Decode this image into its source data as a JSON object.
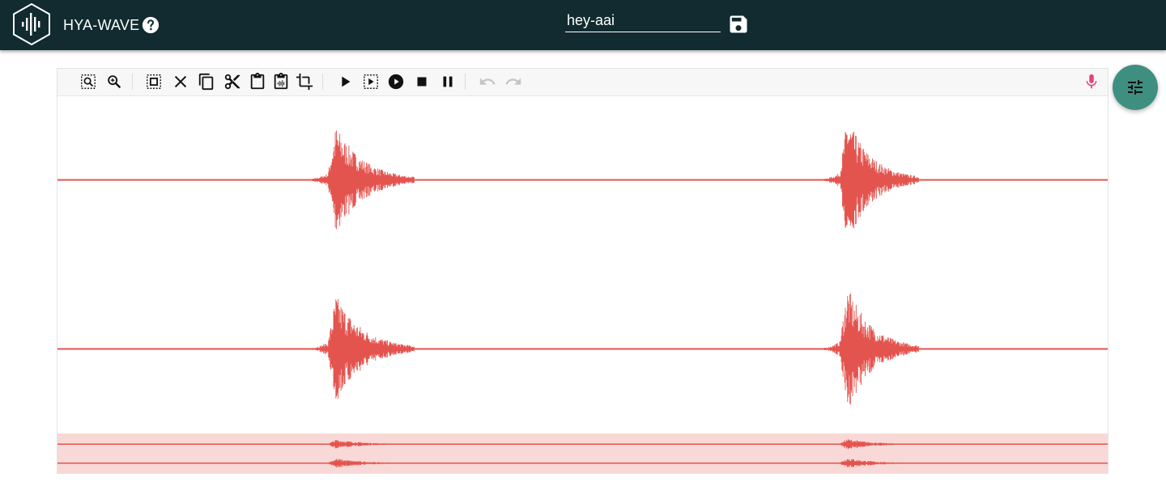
{
  "app": {
    "title": "HYA-WAVE"
  },
  "file": {
    "name": "hey-aai"
  },
  "colors": {
    "header_bg": "#112b30",
    "waveform": "#e4544f",
    "overview_bg": "#f9d9d7",
    "fab": "#3f8f80",
    "record": "#e0457b",
    "disabled": "#c4c4c4"
  },
  "icons": {
    "logo": "hexagon-waveform-icon",
    "help": "help-circle-icon",
    "save": "floppy-disk-icon",
    "zoom_selection": "zoom-to-selection-icon",
    "zoom": "zoom-icon",
    "select_all": "select-all-icon",
    "clear": "close-icon",
    "copy": "copy-icon",
    "cut": "scissors-icon",
    "paste": "clipboard-icon",
    "paste_waveform": "paste-waveform-icon",
    "crop": "crop-icon",
    "play": "play-icon",
    "play_selection": "play-selection-icon",
    "play_circle": "play-circle-icon",
    "stop": "stop-icon",
    "pause": "pause-icon",
    "undo": "undo-icon",
    "redo": "redo-icon",
    "record": "microphone-icon",
    "settings": "tune-sliders-icon"
  },
  "waveform": {
    "channels": 2,
    "bursts": [
      {
        "start": 0.23,
        "end": 0.34,
        "peak": 0.65
      },
      {
        "start": 0.72,
        "end": 0.82,
        "peak": 0.75
      }
    ]
  }
}
